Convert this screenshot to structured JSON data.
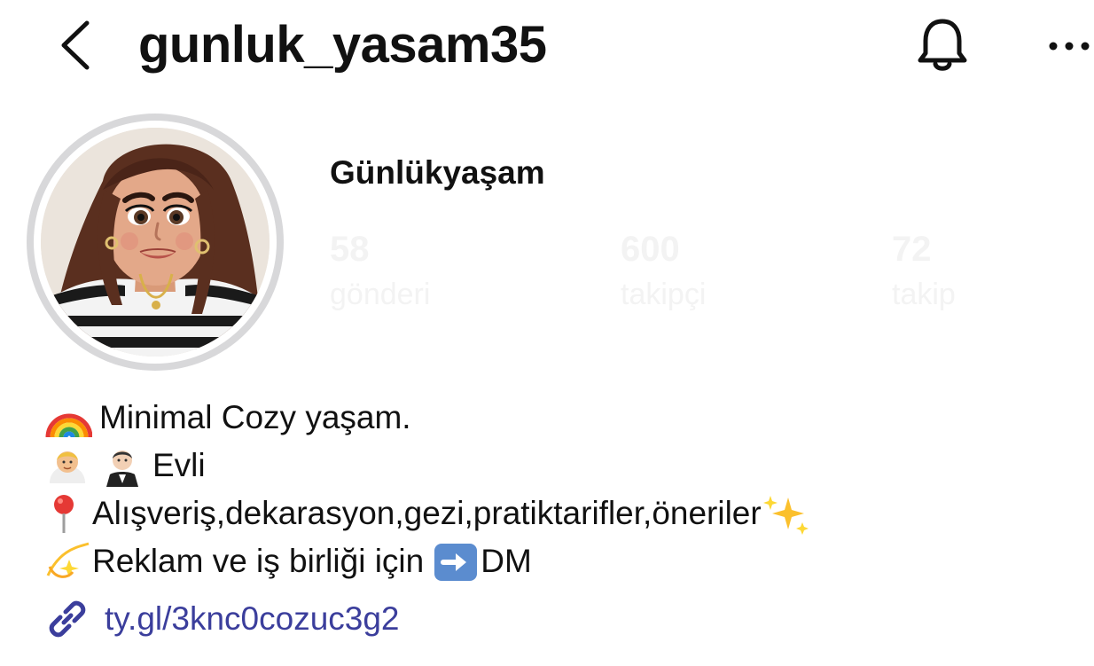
{
  "header": {
    "username": "gunluk_yasam35",
    "back_icon": "chevron-left-icon",
    "bell_icon": "bell-icon",
    "more_icon": "ellipsis-icon"
  },
  "profile": {
    "display_name": "Günlükyaşam",
    "stats": [
      {
        "value": "58",
        "label": "gönderi"
      },
      {
        "value": "600",
        "label": "takipçi"
      },
      {
        "value": "72",
        "label": "takip"
      }
    ]
  },
  "bio": {
    "lines": [
      {
        "emoji": "rainbow",
        "text": "Minimal Cozy yaşam."
      },
      {
        "emoji": "bride-groom",
        "text": "Evli"
      },
      {
        "emoji": "round-pushpin",
        "text": "Alışveriş,dekarasyon,gezi,pratiktarifler,öneriler"
      },
      {
        "emoji": "dizzy",
        "text": "Reklam ve iş birliği için"
      }
    ],
    "line2_trailing": "DM"
  },
  "link": {
    "text": "ty.gl/3knc0cozuc3g2",
    "icon": "link-icon",
    "color": "#3b3e9c"
  }
}
